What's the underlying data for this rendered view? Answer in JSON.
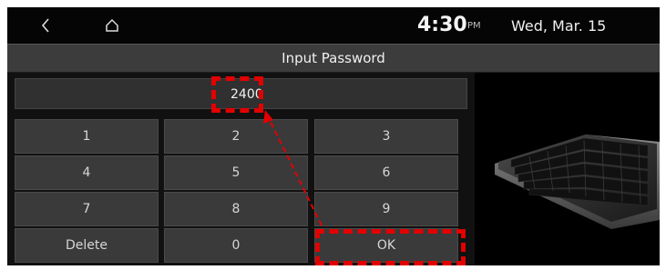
{
  "status_bar": {
    "back_icon": "chevron-left-icon",
    "home_icon": "home-icon",
    "time": "4:30",
    "ampm": "PM",
    "date": "Wed, Mar. 15"
  },
  "title": "Input Password",
  "password_value": "2400",
  "keypad": {
    "k1": "1",
    "k2": "2",
    "k3": "3",
    "k4": "4",
    "k5": "5",
    "k6": "6",
    "k7": "7",
    "k8": "8",
    "k9": "9",
    "delete": "Delete",
    "k0": "0",
    "ok": "OK"
  },
  "colors": {
    "annotation": "#e20000",
    "key_bg": "#3a3a3a",
    "title_bar_bg": "#3c3c3c"
  },
  "image": "keyboard-illustration"
}
